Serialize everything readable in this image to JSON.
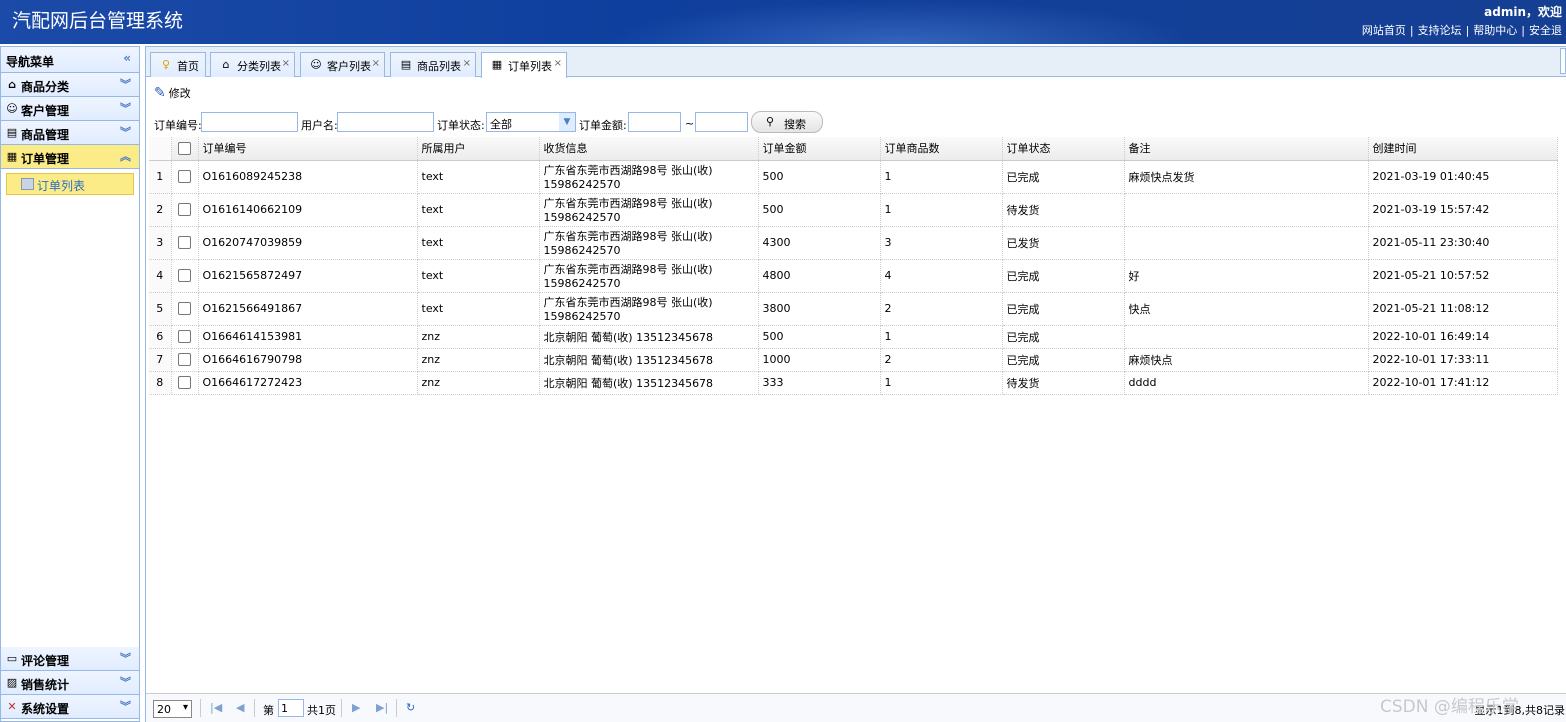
{
  "header": {
    "title": "汽配网后台管理系统",
    "welcome": "admin，欢迎",
    "links": [
      "网站首页",
      "支持论坛",
      "帮助中心",
      "安全退"
    ]
  },
  "sidebar": {
    "head": "导航菜单",
    "groups": [
      {
        "label": "商品分类",
        "icon": "category-icon"
      },
      {
        "label": "客户管理",
        "icon": "customer-icon"
      },
      {
        "label": "商品管理",
        "icon": "goods-icon"
      },
      {
        "label": "订单管理",
        "icon": "order-icon"
      }
    ],
    "active_sub": "订单列表",
    "bottom_groups": [
      {
        "label": "评论管理",
        "icon": "comment-icon"
      },
      {
        "label": "销售统计",
        "icon": "chart-icon"
      },
      {
        "label": "系统设置",
        "icon": "settings-icon"
      }
    ]
  },
  "tabs": [
    {
      "label": "首页",
      "icon": "lightbulb-icon",
      "closable": false
    },
    {
      "label": "分类列表",
      "icon": "category-icon",
      "closable": true
    },
    {
      "label": "客户列表",
      "icon": "customer-icon",
      "closable": true
    },
    {
      "label": "商品列表",
      "icon": "goods-icon",
      "closable": true
    },
    {
      "label": "订单列表",
      "icon": "order-icon",
      "closable": true,
      "active": true
    }
  ],
  "toolbar": {
    "edit_label": "修改"
  },
  "filter": {
    "order_no_label": "订单编号:",
    "order_no_value": "",
    "username_label": "用户名:",
    "username_value": "",
    "status_label": "订单状态:",
    "status_value": "全部",
    "amount_label": "订单金额:",
    "amount_from": "",
    "tilde": "~",
    "amount_to": "",
    "search_label": "搜索"
  },
  "grid": {
    "columns": [
      "订单编号",
      "所属用户",
      "收货信息",
      "订单金额",
      "订单商品数",
      "订单状态",
      "备注",
      "创建时间"
    ],
    "rows": [
      {
        "num": "1",
        "order_no": "O1616089245238",
        "user": "text",
        "addr1": "广东省东莞市西湖路98号 张山(收)",
        "addr2": "15986242570",
        "amount": "500",
        "count": "1",
        "status": "已完成",
        "note": "麻烦快点发货",
        "created": "2021-03-19 01:40:45"
      },
      {
        "num": "2",
        "order_no": "O1616140662109",
        "user": "text",
        "addr1": "广东省东莞市西湖路98号 张山(收)",
        "addr2": "15986242570",
        "amount": "500",
        "count": "1",
        "status": "待发货",
        "note": "",
        "created": "2021-03-19 15:57:42"
      },
      {
        "num": "3",
        "order_no": "O1620747039859",
        "user": "text",
        "addr1": "广东省东莞市西湖路98号 张山(收)",
        "addr2": "15986242570",
        "amount": "4300",
        "count": "3",
        "status": "已发货",
        "note": "",
        "created": "2021-05-11 23:30:40"
      },
      {
        "num": "4",
        "order_no": "O1621565872497",
        "user": "text",
        "addr1": "广东省东莞市西湖路98号 张山(收)",
        "addr2": "15986242570",
        "amount": "4800",
        "count": "4",
        "status": "已完成",
        "note": "好",
        "created": "2021-05-21 10:57:52"
      },
      {
        "num": "5",
        "order_no": "O1621566491867",
        "user": "text",
        "addr1": "广东省东莞市西湖路98号 张山(收)",
        "addr2": "15986242570",
        "amount": "3800",
        "count": "2",
        "status": "已完成",
        "note": "快点",
        "created": "2021-05-21 11:08:12"
      },
      {
        "num": "6",
        "order_no": "O1664614153981",
        "user": "znz",
        "addr1": "北京朝阳 葡萄(收) 13512345678",
        "addr2": "",
        "amount": "500",
        "count": "1",
        "status": "已完成",
        "note": "",
        "created": "2022-10-01 16:49:14"
      },
      {
        "num": "7",
        "order_no": "O1664616790798",
        "user": "znz",
        "addr1": "北京朝阳 葡萄(收) 13512345678",
        "addr2": "",
        "amount": "1000",
        "count": "2",
        "status": "已完成",
        "note": "麻烦快点",
        "created": "2022-10-01 17:33:11"
      },
      {
        "num": "8",
        "order_no": "O1664617272423",
        "user": "znz",
        "addr1": "北京朝阳 葡萄(收) 13512345678",
        "addr2": "",
        "amount": "333",
        "count": "1",
        "status": "待发货",
        "note": "dddd",
        "created": "2022-10-01 17:41:12"
      }
    ]
  },
  "pager": {
    "page_size": "20",
    "page_prefix": "第",
    "page_value": "1",
    "page_total": "共1页",
    "info": "显示1到8,共8记录"
  },
  "watermark": "CSDN @编程乐学"
}
